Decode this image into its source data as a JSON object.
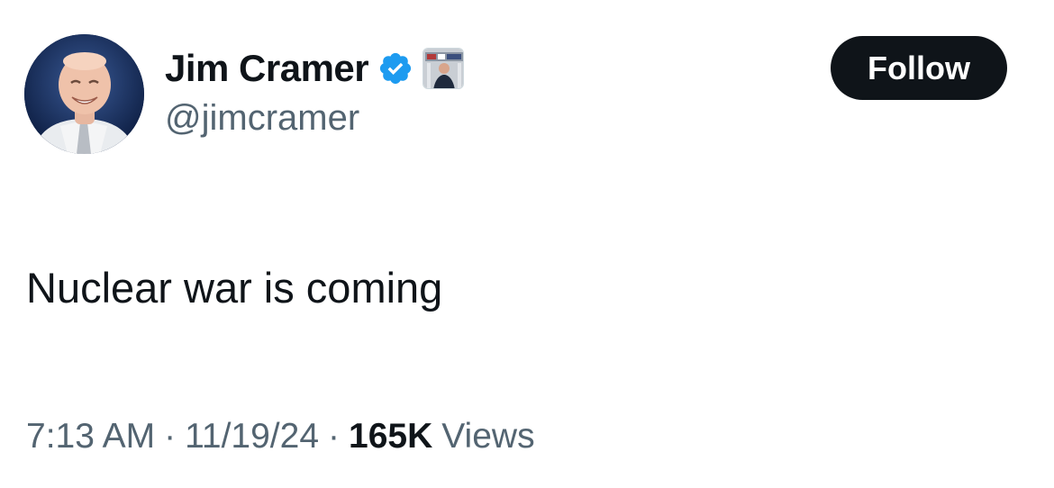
{
  "author": {
    "display_name": "Jim Cramer",
    "handle": "@jimcramer",
    "verified_icon": "verified-badge-icon",
    "affiliate_icon": "affiliate-badge-icon"
  },
  "follow_button": {
    "label": "Follow"
  },
  "tweet": {
    "text": "Nuclear war is coming"
  },
  "meta": {
    "time": "7:13 AM",
    "separator": "·",
    "date": "11/19/24",
    "views_count": "165K",
    "views_label": "Views"
  },
  "colors": {
    "text_primary": "#0f1419",
    "text_secondary": "#536471",
    "verified_blue": "#1d9bf0",
    "button_bg": "#0f1419",
    "button_text": "#ffffff"
  }
}
